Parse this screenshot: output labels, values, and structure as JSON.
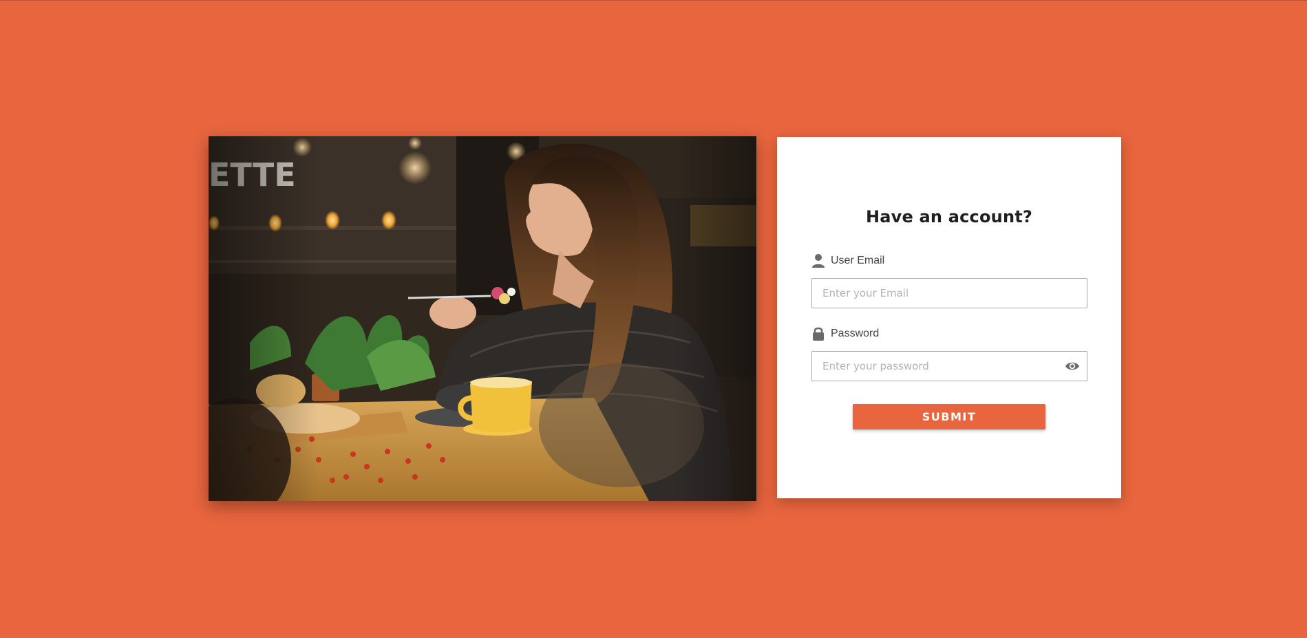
{
  "colors": {
    "background": "#e8653e",
    "card": "#ffffff",
    "accent": "#e8653e",
    "title": "#1f1f1f",
    "label": "#444444"
  },
  "hero": {
    "alt": "Woman enjoying a meal at a cafe table"
  },
  "login": {
    "title": "Have an account?",
    "email": {
      "label": "User Email",
      "placeholder": "Enter your Email",
      "icon": "user-icon"
    },
    "password": {
      "label": "Password",
      "placeholder": "Enter your password",
      "icon": "lock-icon",
      "toggle_icon": "eye-icon"
    },
    "submit_label": "SUBMIT"
  }
}
